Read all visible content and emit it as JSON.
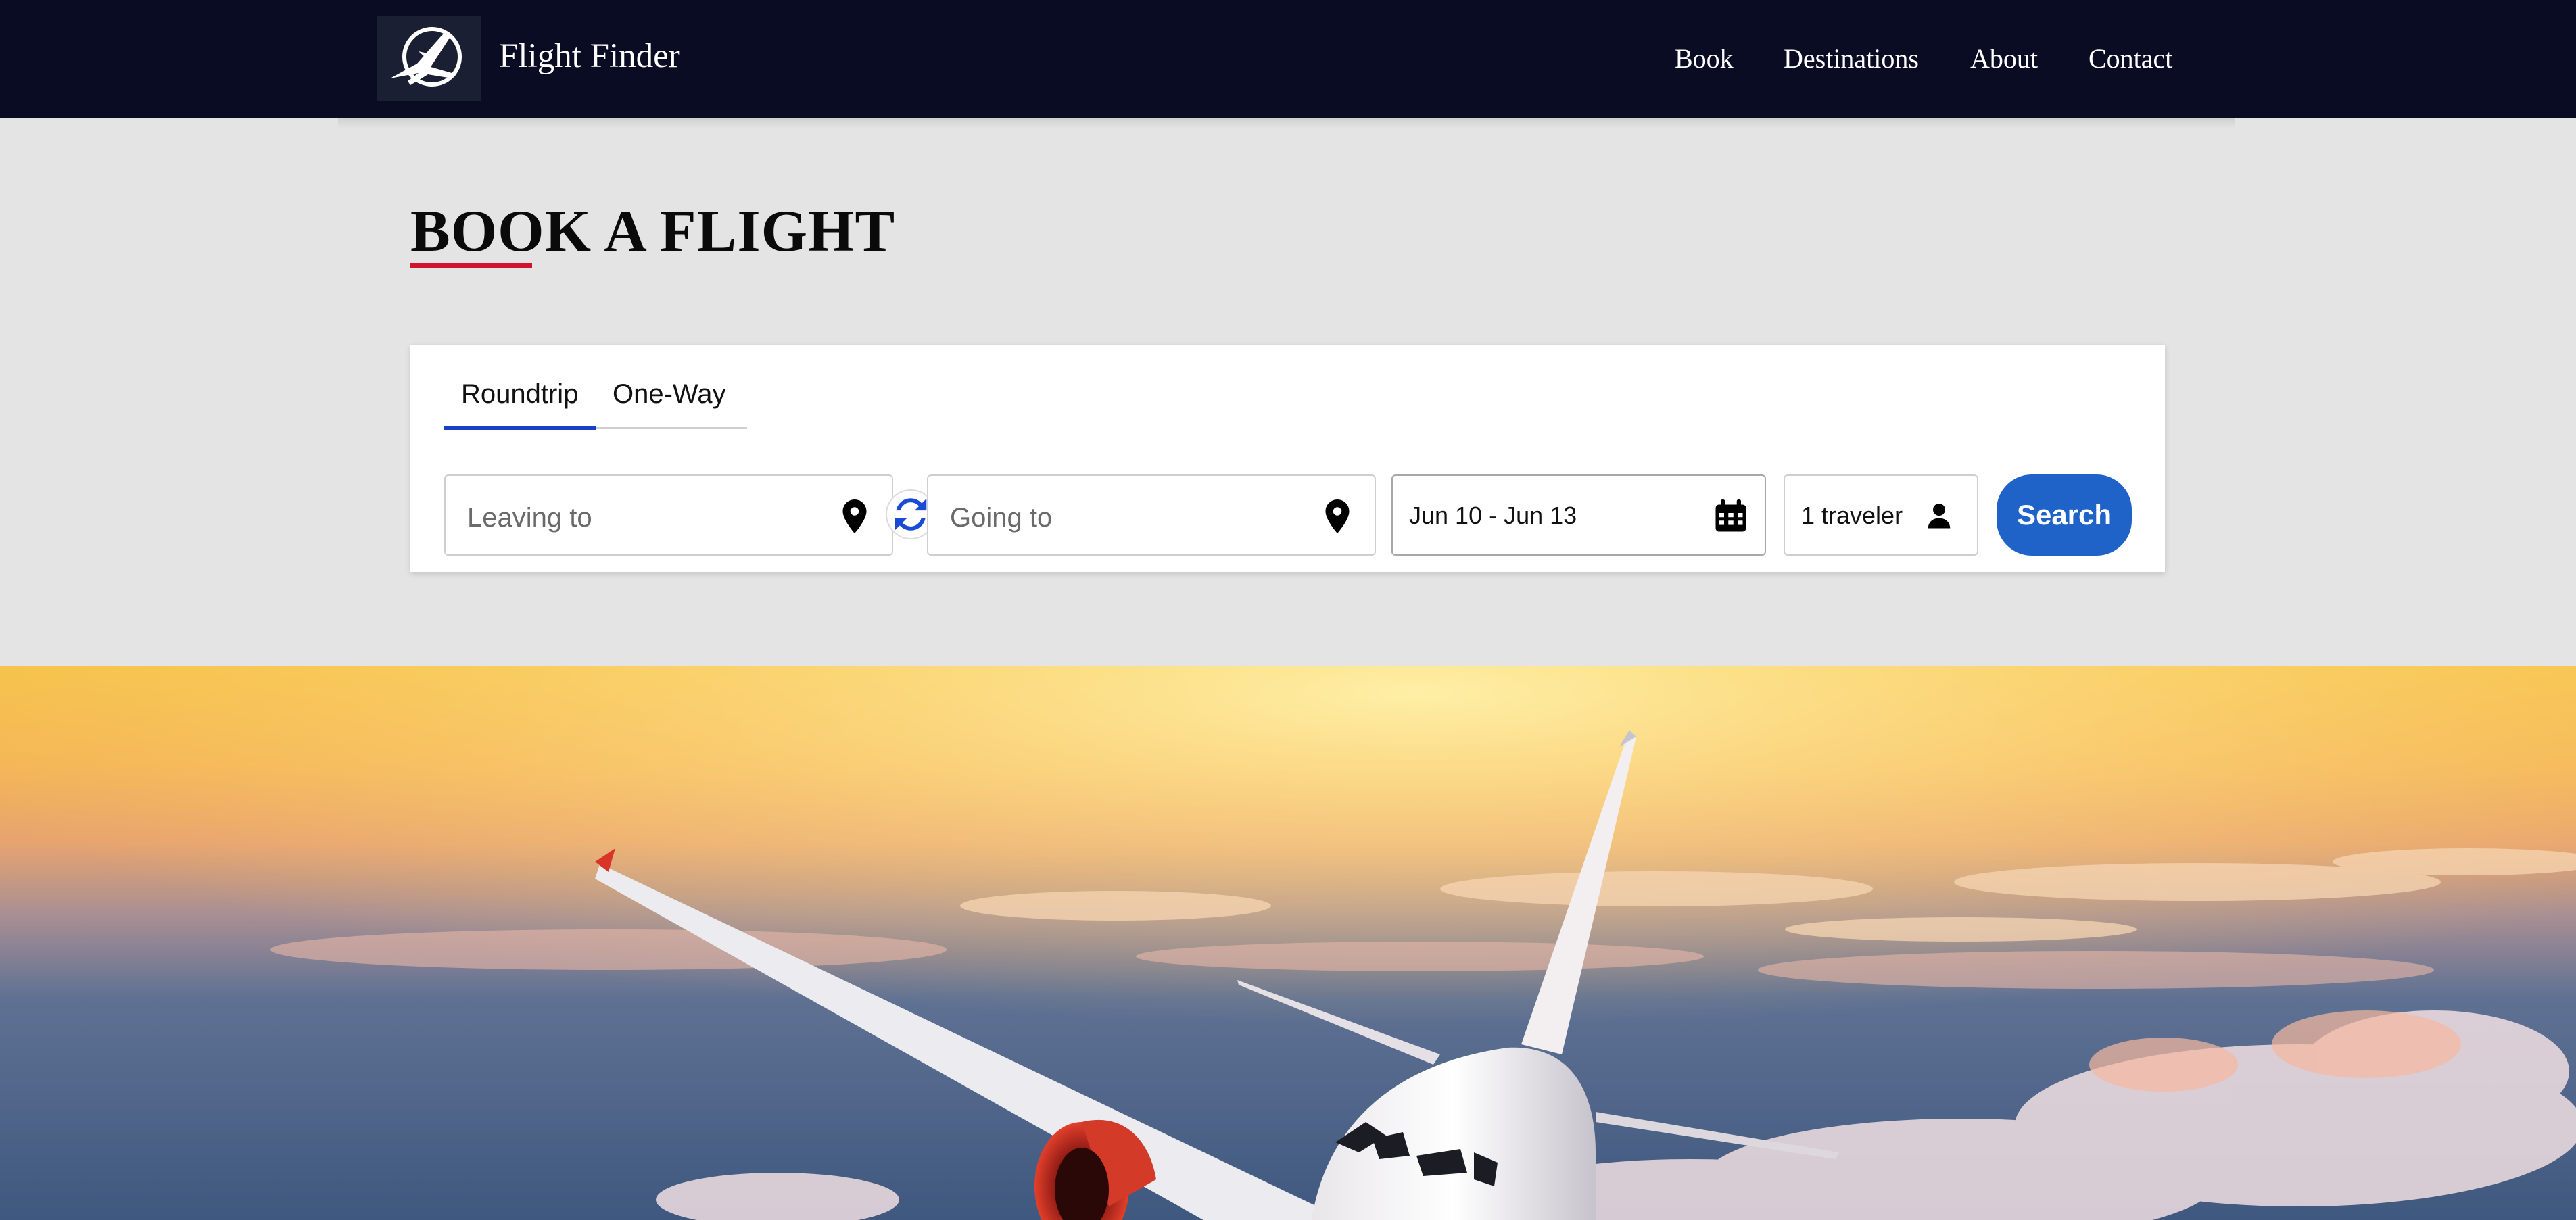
{
  "navbar": {
    "brand": "Flight Finder",
    "logo_icon": "airplane-logo-icon",
    "links": [
      {
        "label": "Book"
      },
      {
        "label": "Destinations"
      },
      {
        "label": "About"
      },
      {
        "label": "Contact"
      }
    ]
  },
  "page": {
    "title": "BOOK A FLIGHT"
  },
  "booking": {
    "tabs": [
      {
        "label": "Roundtrip",
        "active": true
      },
      {
        "label": "One-Way",
        "active": false
      }
    ],
    "leaving": {
      "placeholder": "Leaving to",
      "value": "",
      "icon": "map-pin-icon"
    },
    "swap_icon": "swap-arrows-icon",
    "going": {
      "placeholder": "Going to",
      "value": "",
      "icon": "map-pin-icon"
    },
    "dates": {
      "value": "Jun 10 - Jun 13",
      "icon": "calendar-icon"
    },
    "travelers": {
      "value": "1 traveler",
      "icon": "person-icon"
    },
    "search_label": "Search"
  },
  "colors": {
    "navbar_bg": "#0a0c24",
    "page_bg": "#e4e4e4",
    "title_accent": "#d0142c",
    "tab_active": "#1b3fc0",
    "search_button": "#1f63c9"
  }
}
